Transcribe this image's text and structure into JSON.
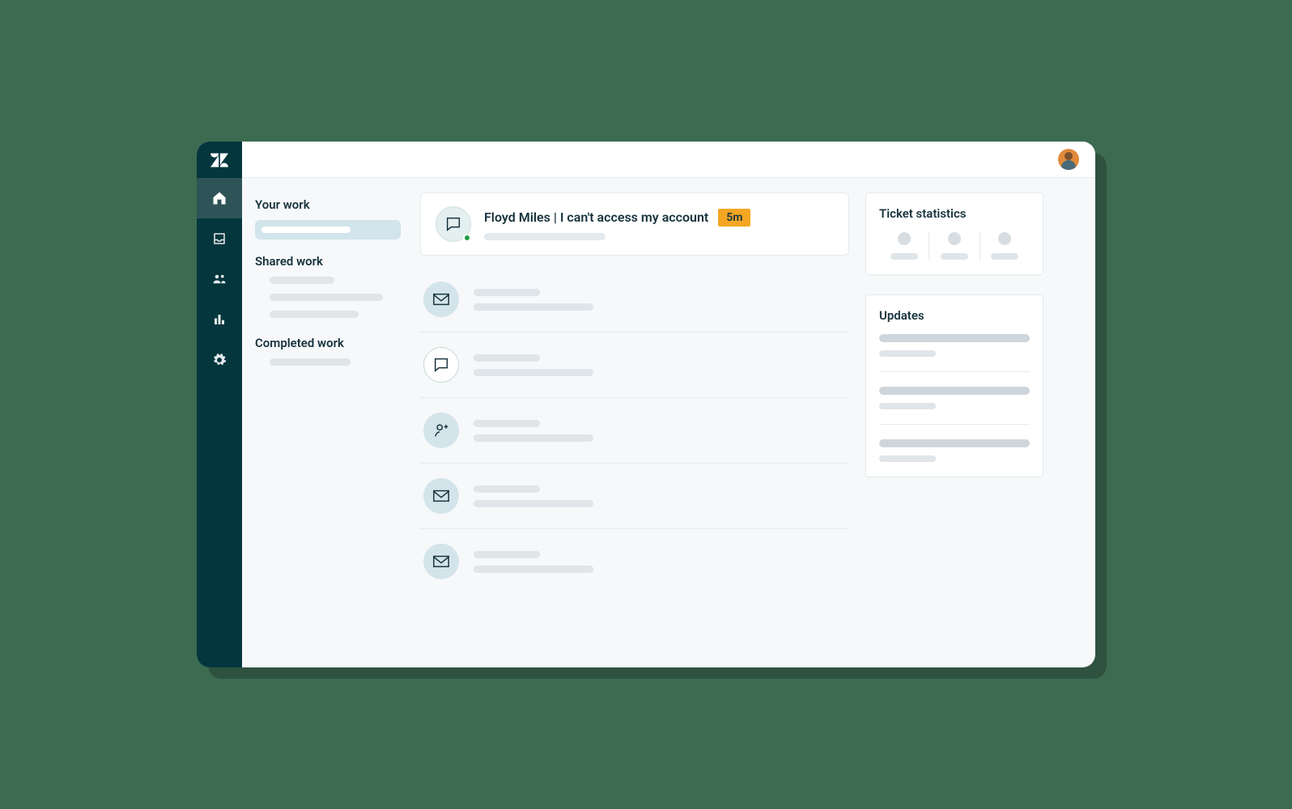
{
  "nav": {
    "items": [
      {
        "name": "home"
      },
      {
        "name": "views"
      },
      {
        "name": "customers"
      },
      {
        "name": "reporting"
      },
      {
        "name": "admin"
      }
    ]
  },
  "sidebar": {
    "sections": {
      "your_work": "Your work",
      "shared_work": "Shared work",
      "completed_work": "Completed work"
    }
  },
  "feed": {
    "highlight": {
      "customer": "Floyd Miles",
      "separator": " | ",
      "subject": "I can't access my account",
      "time_badge": "5m",
      "channel": "chat",
      "presence": "online"
    },
    "items": [
      {
        "channel": "email"
      },
      {
        "channel": "chat"
      },
      {
        "channel": "add-user"
      },
      {
        "channel": "email"
      },
      {
        "channel": "email"
      }
    ]
  },
  "right": {
    "stats_title": "Ticket statistics",
    "updates_title": "Updates"
  },
  "colors": {
    "brand_dark": "#03363d",
    "accent_orange": "#f5a623",
    "presence_green": "#1f9c41"
  }
}
